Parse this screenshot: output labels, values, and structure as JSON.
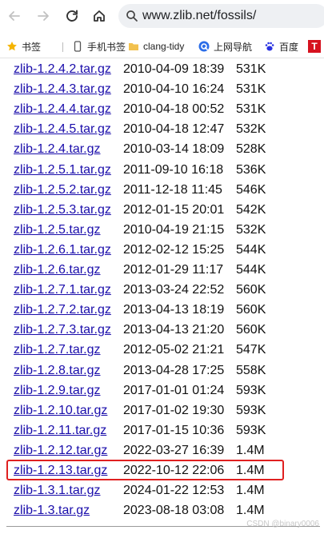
{
  "browser": {
    "url": "www.zlib.net/fossils/",
    "bookmarks": [
      {
        "label": "书签",
        "icon": "star-icon"
      },
      {
        "label": "手机书签",
        "icon": "phone-icon"
      },
      {
        "label": "clang-tidy",
        "icon": "folder-icon"
      },
      {
        "label": "上网导航",
        "icon": "q-logo-icon"
      },
      {
        "label": "百度",
        "icon": "baidu-paw-icon"
      },
      {
        "label": "T",
        "icon": "red-t-logo"
      }
    ]
  },
  "files": [
    {
      "name": "zlib-1.2.4.2.tar.gz",
      "date": "2010-04-09 18:39",
      "size": "531K"
    },
    {
      "name": "zlib-1.2.4.3.tar.gz",
      "date": "2010-04-10 16:24",
      "size": "531K"
    },
    {
      "name": "zlib-1.2.4.4.tar.gz",
      "date": "2010-04-18 00:52",
      "size": "531K"
    },
    {
      "name": "zlib-1.2.4.5.tar.gz",
      "date": "2010-04-18 12:47",
      "size": "532K"
    },
    {
      "name": "zlib-1.2.4.tar.gz",
      "date": "2010-03-14 18:09",
      "size": "528K"
    },
    {
      "name": "zlib-1.2.5.1.tar.gz",
      "date": "2011-09-10 16:18",
      "size": "536K"
    },
    {
      "name": "zlib-1.2.5.2.tar.gz",
      "date": "2011-12-18 11:45",
      "size": "546K"
    },
    {
      "name": "zlib-1.2.5.3.tar.gz",
      "date": "2012-01-15 20:01",
      "size": "542K"
    },
    {
      "name": "zlib-1.2.5.tar.gz",
      "date": "2010-04-19 21:15",
      "size": "532K"
    },
    {
      "name": "zlib-1.2.6.1.tar.gz",
      "date": "2012-02-12 15:25",
      "size": "544K"
    },
    {
      "name": "zlib-1.2.6.tar.gz",
      "date": "2012-01-29 11:17",
      "size": "544K"
    },
    {
      "name": "zlib-1.2.7.1.tar.gz",
      "date": "2013-03-24 22:52",
      "size": "560K"
    },
    {
      "name": "zlib-1.2.7.2.tar.gz",
      "date": "2013-04-13 18:19",
      "size": "560K"
    },
    {
      "name": "zlib-1.2.7.3.tar.gz",
      "date": "2013-04-13 21:20",
      "size": "560K"
    },
    {
      "name": "zlib-1.2.7.tar.gz",
      "date": "2012-05-02 21:21",
      "size": "547K"
    },
    {
      "name": "zlib-1.2.8.tar.gz",
      "date": "2013-04-28 17:25",
      "size": "558K"
    },
    {
      "name": "zlib-1.2.9.tar.gz",
      "date": "2017-01-01 01:24",
      "size": "593K"
    },
    {
      "name": "zlib-1.2.10.tar.gz",
      "date": "2017-01-02 19:30",
      "size": "593K"
    },
    {
      "name": "zlib-1.2.11.tar.gz",
      "date": "2017-01-15 10:36",
      "size": "593K"
    },
    {
      "name": "zlib-1.2.12.tar.gz",
      "date": "2022-03-27 16:39",
      "size": "1.4M"
    },
    {
      "name": "zlib-1.2.13.tar.gz",
      "date": "2022-10-12 22:06",
      "size": "1.4M",
      "highlighted": true
    },
    {
      "name": "zlib-1.3.1.tar.gz",
      "date": "2024-01-22 12:53",
      "size": "1.4M"
    },
    {
      "name": "zlib-1.3.tar.gz",
      "date": "2023-08-18 03:08",
      "size": "1.4M"
    }
  ],
  "watermark": "CSDN @binary0006",
  "colors": {
    "link": "#1a0dab",
    "highlight": "#e02020"
  }
}
